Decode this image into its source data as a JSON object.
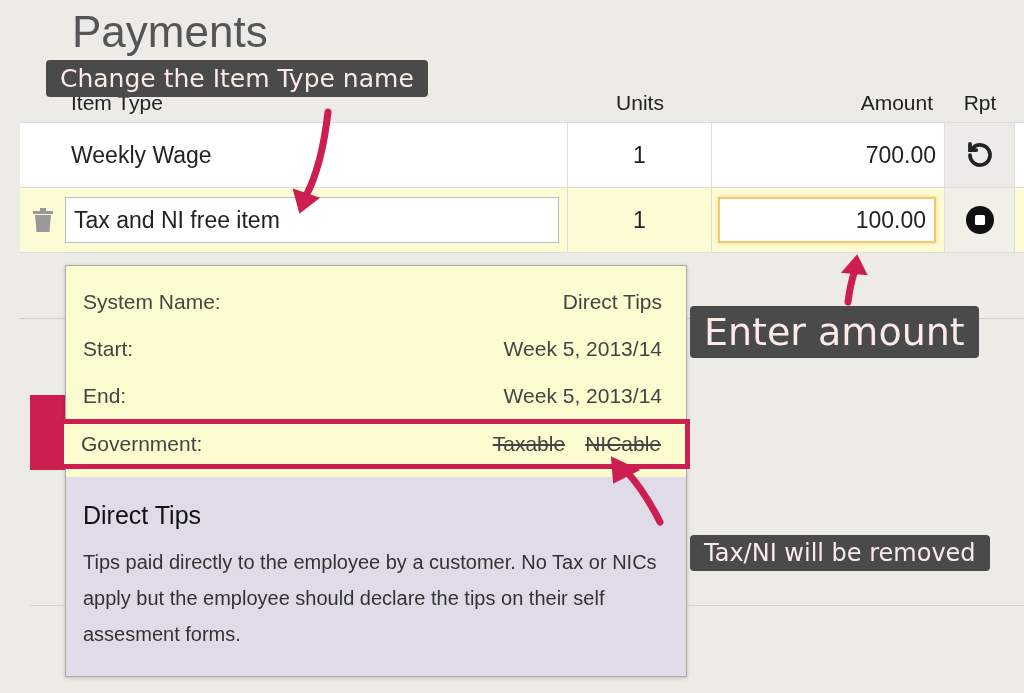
{
  "title": "Payments",
  "table": {
    "columns": [
      "Item Type",
      "Units",
      "Amount",
      "Rpt"
    ],
    "rows": [
      {
        "kind": "static",
        "item": "Weekly Wage",
        "units": "1",
        "amount": "700.00",
        "repeat": true
      },
      {
        "kind": "editing",
        "item": "Tax and NI free item",
        "units": "1",
        "amount": "100.00",
        "repeat": false
      }
    ]
  },
  "popup": {
    "fields": [
      {
        "label": "System Name:",
        "value": "Direct Tips"
      },
      {
        "label": "Start:",
        "value": "Week 5, 2013/14"
      },
      {
        "label": "End:",
        "value": "Week 5, 2013/14"
      }
    ],
    "government": {
      "label": "Government:",
      "flags": [
        {
          "text": "Taxable",
          "struck": true
        },
        {
          "text": "NICable",
          "struck": true
        }
      ]
    },
    "heading": "Direct Tips",
    "description": "Tips paid directly to the employee by a customer. No Tax or NICs apply but the employee should declare the tips on their self assesment forms."
  },
  "callouts": [
    {
      "text": "Change the Item Type name"
    },
    {
      "text": "Enter amount"
    },
    {
      "text": "Tax/NI will be removed"
    }
  ]
}
